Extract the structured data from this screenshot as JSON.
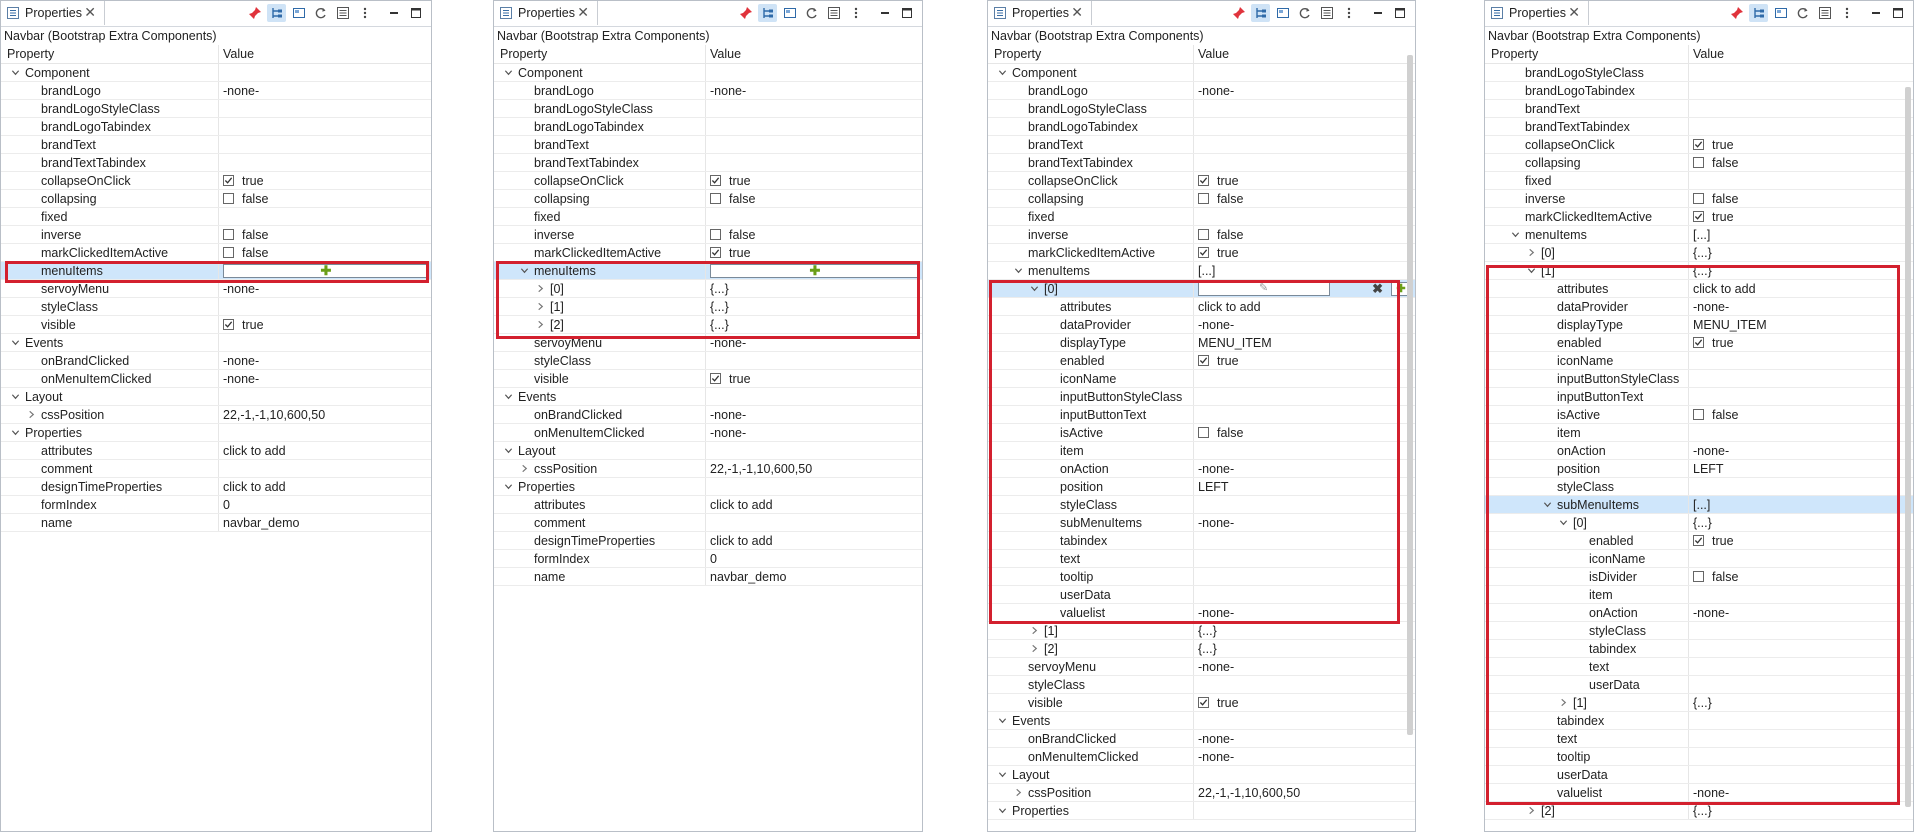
{
  "tab_label": "Properties",
  "subtitle": "Navbar (Bootstrap Extra Components)",
  "col_property": "Property",
  "col_value": "Value",
  "colors": {
    "highlight": "#d3202e",
    "selection": "#cfe6fb",
    "plus": "#6a9e17"
  },
  "panels": [
    {
      "rows": [
        {
          "d": 0,
          "tw": "open",
          "n": "Component"
        },
        {
          "d": 1,
          "n": "brandLogo",
          "v": "-none-"
        },
        {
          "d": 1,
          "n": "brandLogoStyleClass"
        },
        {
          "d": 1,
          "n": "brandLogoTabindex"
        },
        {
          "d": 1,
          "n": "brandText"
        },
        {
          "d": 1,
          "n": "brandTextTabindex"
        },
        {
          "d": 1,
          "n": "collapseOnClick",
          "cb": true,
          "v": "true"
        },
        {
          "d": 1,
          "n": "collapsing",
          "cb": false,
          "v": "false"
        },
        {
          "d": 1,
          "n": "fixed"
        },
        {
          "d": 1,
          "n": "inverse",
          "cb": false,
          "v": "false"
        },
        {
          "d": 1,
          "n": "markClickedItemActive",
          "cb": false,
          "v": "false"
        },
        {
          "d": 1,
          "n": "menuItems",
          "sel": true,
          "editor": "plus"
        },
        {
          "d": 1,
          "n": "servoyMenu",
          "v": "-none-"
        },
        {
          "d": 1,
          "n": "styleClass"
        },
        {
          "d": 1,
          "n": "visible",
          "cb": true,
          "v": "true"
        },
        {
          "d": 0,
          "tw": "open",
          "n": "Events"
        },
        {
          "d": 1,
          "n": "onBrandClicked",
          "v": "-none-"
        },
        {
          "d": 1,
          "n": "onMenuItemClicked",
          "v": "-none-"
        },
        {
          "d": 0,
          "tw": "open",
          "n": "Layout"
        },
        {
          "d": 1,
          "tw": "closed",
          "n": "cssPosition",
          "v": "22,-1,-1,10,600,50"
        },
        {
          "d": 0,
          "tw": "open",
          "n": "Properties"
        },
        {
          "d": 1,
          "n": "attributes",
          "v": "click to add"
        },
        {
          "d": 1,
          "n": "comment"
        },
        {
          "d": 1,
          "n": "designTimeProperties",
          "v": "click to add"
        },
        {
          "d": 1,
          "n": "formIndex",
          "v": "0"
        },
        {
          "d": 1,
          "n": "name",
          "v": "navbar_demo"
        }
      ]
    },
    {
      "rows": [
        {
          "d": 0,
          "tw": "open",
          "n": "Component"
        },
        {
          "d": 1,
          "n": "brandLogo",
          "v": "-none-"
        },
        {
          "d": 1,
          "n": "brandLogoStyleClass"
        },
        {
          "d": 1,
          "n": "brandLogoTabindex"
        },
        {
          "d": 1,
          "n": "brandText"
        },
        {
          "d": 1,
          "n": "brandTextTabindex"
        },
        {
          "d": 1,
          "n": "collapseOnClick",
          "cb": true,
          "v": "true"
        },
        {
          "d": 1,
          "n": "collapsing",
          "cb": false,
          "v": "false"
        },
        {
          "d": 1,
          "n": "fixed"
        },
        {
          "d": 1,
          "n": "inverse",
          "cb": false,
          "v": "false"
        },
        {
          "d": 1,
          "n": "markClickedItemActive",
          "cb": true,
          "v": "true"
        },
        {
          "d": 1,
          "tw": "open",
          "n": "menuItems",
          "sel": true,
          "editor": "plus"
        },
        {
          "d": 2,
          "tw": "closed",
          "n": "[0]",
          "v": "{...}"
        },
        {
          "d": 2,
          "tw": "closed",
          "n": "[1]",
          "v": "{...}"
        },
        {
          "d": 2,
          "tw": "closed",
          "n": "[2]",
          "v": "{...}"
        },
        {
          "d": 1,
          "n": "servoyMenu",
          "v": "-none-"
        },
        {
          "d": 1,
          "n": "styleClass"
        },
        {
          "d": 1,
          "n": "visible",
          "cb": true,
          "v": "true"
        },
        {
          "d": 0,
          "tw": "open",
          "n": "Events"
        },
        {
          "d": 1,
          "n": "onBrandClicked",
          "v": "-none-"
        },
        {
          "d": 1,
          "n": "onMenuItemClicked",
          "v": "-none-"
        },
        {
          "d": 0,
          "tw": "open",
          "n": "Layout"
        },
        {
          "d": 1,
          "tw": "closed",
          "n": "cssPosition",
          "v": "22,-1,-1,10,600,50"
        },
        {
          "d": 0,
          "tw": "open",
          "n": "Properties"
        },
        {
          "d": 1,
          "n": "attributes",
          "v": "click to add"
        },
        {
          "d": 1,
          "n": "comment"
        },
        {
          "d": 1,
          "n": "designTimeProperties",
          "v": "click to add"
        },
        {
          "d": 1,
          "n": "formIndex",
          "v": "0"
        },
        {
          "d": 1,
          "n": "name",
          "v": "navbar_demo"
        }
      ]
    },
    {
      "rows": [
        {
          "d": 0,
          "tw": "open",
          "n": "Component"
        },
        {
          "d": 1,
          "n": "brandLogo",
          "v": "-none-"
        },
        {
          "d": 1,
          "n": "brandLogoStyleClass"
        },
        {
          "d": 1,
          "n": "brandLogoTabindex"
        },
        {
          "d": 1,
          "n": "brandText"
        },
        {
          "d": 1,
          "n": "brandTextTabindex"
        },
        {
          "d": 1,
          "n": "collapseOnClick",
          "cb": true,
          "v": "true"
        },
        {
          "d": 1,
          "n": "collapsing",
          "cb": false,
          "v": "false"
        },
        {
          "d": 1,
          "n": "fixed"
        },
        {
          "d": 1,
          "n": "inverse",
          "cb": false,
          "v": "false"
        },
        {
          "d": 1,
          "n": "markClickedItemActive",
          "cb": true,
          "v": "true"
        },
        {
          "d": 1,
          "tw": "open",
          "n": "menuItems",
          "v": "[...]"
        },
        {
          "d": 2,
          "tw": "open",
          "n": "[0]",
          "sel": true,
          "editor": "edit"
        },
        {
          "d": 3,
          "n": "attributes",
          "v": "click to add"
        },
        {
          "d": 3,
          "n": "dataProvider",
          "v": "-none-"
        },
        {
          "d": 3,
          "n": "displayType",
          "v": "MENU_ITEM"
        },
        {
          "d": 3,
          "n": "enabled",
          "cb": true,
          "v": "true"
        },
        {
          "d": 3,
          "n": "iconName"
        },
        {
          "d": 3,
          "n": "inputButtonStyleClass"
        },
        {
          "d": 3,
          "n": "inputButtonText"
        },
        {
          "d": 3,
          "n": "isActive",
          "cb": false,
          "v": "false"
        },
        {
          "d": 3,
          "n": "item"
        },
        {
          "d": 3,
          "n": "onAction",
          "v": "-none-"
        },
        {
          "d": 3,
          "n": "position",
          "v": "LEFT"
        },
        {
          "d": 3,
          "n": "styleClass"
        },
        {
          "d": 3,
          "n": "subMenuItems",
          "v": "-none-"
        },
        {
          "d": 3,
          "n": "tabindex"
        },
        {
          "d": 3,
          "n": "text"
        },
        {
          "d": 3,
          "n": "tooltip"
        },
        {
          "d": 3,
          "n": "userData"
        },
        {
          "d": 3,
          "n": "valuelist",
          "v": "-none-"
        },
        {
          "d": 2,
          "tw": "closed",
          "n": "[1]",
          "v": "{...}"
        },
        {
          "d": 2,
          "tw": "closed",
          "n": "[2]",
          "v": "{...}"
        },
        {
          "d": 1,
          "n": "servoyMenu",
          "v": "-none-"
        },
        {
          "d": 1,
          "n": "styleClass"
        },
        {
          "d": 1,
          "n": "visible",
          "cb": true,
          "v": "true"
        },
        {
          "d": 0,
          "tw": "open",
          "n": "Events"
        },
        {
          "d": 1,
          "n": "onBrandClicked",
          "v": "-none-"
        },
        {
          "d": 1,
          "n": "onMenuItemClicked",
          "v": "-none-"
        },
        {
          "d": 0,
          "tw": "open",
          "n": "Layout"
        },
        {
          "d": 1,
          "tw": "closed",
          "n": "cssPosition",
          "v": "22,-1,-1,10,600,50"
        },
        {
          "d": 0,
          "tw": "open",
          "n": "Properties"
        }
      ]
    },
    {
      "rows": [
        {
          "d": 1,
          "n": "brandLogoStyleClass"
        },
        {
          "d": 1,
          "n": "brandLogoTabindex"
        },
        {
          "d": 1,
          "n": "brandText"
        },
        {
          "d": 1,
          "n": "brandTextTabindex"
        },
        {
          "d": 1,
          "n": "collapseOnClick",
          "cb": true,
          "v": "true"
        },
        {
          "d": 1,
          "n": "collapsing",
          "cb": false,
          "v": "false"
        },
        {
          "d": 1,
          "n": "fixed"
        },
        {
          "d": 1,
          "n": "inverse",
          "cb": false,
          "v": "false"
        },
        {
          "d": 1,
          "n": "markClickedItemActive",
          "cb": true,
          "v": "true"
        },
        {
          "d": 1,
          "tw": "open",
          "n": "menuItems",
          "v": "[...]"
        },
        {
          "d": 2,
          "tw": "closed",
          "n": "[0]",
          "v": "{...}"
        },
        {
          "d": 2,
          "tw": "open",
          "n": "[1]",
          "v": "{...}"
        },
        {
          "d": 3,
          "n": "attributes",
          "v": "click to add"
        },
        {
          "d": 3,
          "n": "dataProvider",
          "v": "-none-"
        },
        {
          "d": 3,
          "n": "displayType",
          "v": "MENU_ITEM"
        },
        {
          "d": 3,
          "n": "enabled",
          "cb": true,
          "v": "true"
        },
        {
          "d": 3,
          "n": "iconName"
        },
        {
          "d": 3,
          "n": "inputButtonStyleClass"
        },
        {
          "d": 3,
          "n": "inputButtonText"
        },
        {
          "d": 3,
          "n": "isActive",
          "cb": false,
          "v": "false"
        },
        {
          "d": 3,
          "n": "item"
        },
        {
          "d": 3,
          "n": "onAction",
          "v": "-none-"
        },
        {
          "d": 3,
          "n": "position",
          "v": "LEFT"
        },
        {
          "d": 3,
          "n": "styleClass"
        },
        {
          "d": 3,
          "tw": "open",
          "n": "subMenuItems",
          "v": "[...]",
          "sel": true
        },
        {
          "d": 4,
          "tw": "open",
          "n": "[0]",
          "v": "{...}"
        },
        {
          "d": 5,
          "n": "enabled",
          "cb": true,
          "v": "true"
        },
        {
          "d": 5,
          "n": "iconName"
        },
        {
          "d": 5,
          "n": "isDivider",
          "cb": false,
          "v": "false"
        },
        {
          "d": 5,
          "n": "item"
        },
        {
          "d": 5,
          "n": "onAction",
          "v": "-none-"
        },
        {
          "d": 5,
          "n": "styleClass"
        },
        {
          "d": 5,
          "n": "tabindex"
        },
        {
          "d": 5,
          "n": "text"
        },
        {
          "d": 5,
          "n": "userData"
        },
        {
          "d": 4,
          "tw": "closed",
          "n": "[1]",
          "v": "{...}"
        },
        {
          "d": 3,
          "n": "tabindex"
        },
        {
          "d": 3,
          "n": "text"
        },
        {
          "d": 3,
          "n": "tooltip"
        },
        {
          "d": 3,
          "n": "userData"
        },
        {
          "d": 3,
          "n": "valuelist",
          "v": "-none-"
        },
        {
          "d": 2,
          "tw": "closed",
          "n": "[2]",
          "v": "{...}"
        }
      ]
    }
  ]
}
